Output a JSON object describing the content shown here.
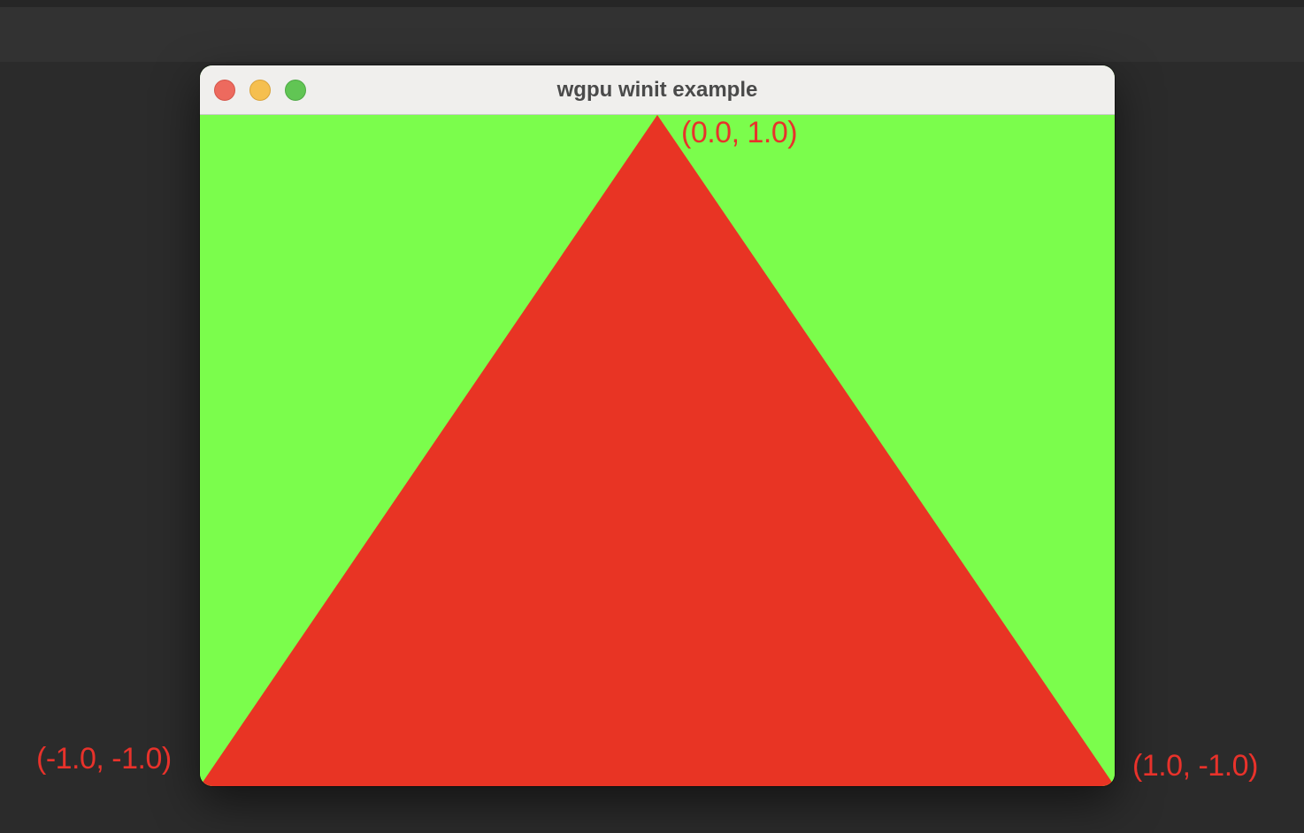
{
  "window": {
    "title": "wgpu winit example",
    "controls": {
      "close": "close-button",
      "minimize": "minimize-button",
      "zoom": "zoom-button"
    }
  },
  "scene": {
    "clear_color": "#7bfd4c",
    "triangle_color": "#e83424",
    "vertices": [
      {
        "label": "(0.0, 1.0)",
        "x": 0.0,
        "y": 1.0
      },
      {
        "label": "(-1.0, -1.0)",
        "x": -1.0,
        "y": -1.0
      },
      {
        "label": "(1.0, -1.0)",
        "x": 1.0,
        "y": -1.0
      }
    ]
  },
  "annotations": {
    "label_color": "#e8322b",
    "top_vertex": "(0.0, 1.0)",
    "bottom_left_vertex": "(-1.0, -1.0)",
    "bottom_right_vertex": "(1.0, -1.0)"
  }
}
